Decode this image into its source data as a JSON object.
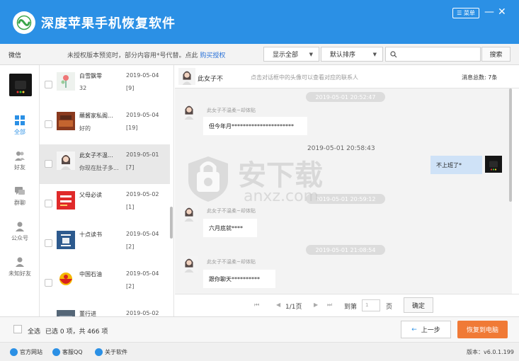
{
  "app": {
    "title": "深度苹果手机恢复软件",
    "menu_label": "菜单",
    "accent": "#2b90e5"
  },
  "toolbar": {
    "app_label": "微信",
    "notice_text": "未授权版本预览时，部分内容用*号代替。点此",
    "notice_link": "购买授权",
    "filter_label": "显示全部",
    "sort_label": "默认排序",
    "search_placeholder": "",
    "search_button": "搜索"
  },
  "nav": {
    "items": [
      {
        "label": "全部",
        "icon": "grid-icon"
      },
      {
        "label": "好友",
        "icon": "friends-icon"
      },
      {
        "label": "群聊",
        "icon": "group-chat-icon"
      },
      {
        "label": "公众号",
        "icon": "official-account-icon"
      },
      {
        "label": "未知好友",
        "icon": "unknown-friend-icon"
      }
    ]
  },
  "contacts": [
    {
      "name": "白雪飘零",
      "preview": "32",
      "date": "2019-05-04",
      "count": "[9]"
    },
    {
      "name": "蘸酱家私阁...",
      "preview": "好的",
      "date": "2019-05-04",
      "count": "[19]"
    },
    {
      "name": "此女子不温...",
      "preview": "你现在肚子多...",
      "date": "2019-05-01",
      "count": "[7]"
    },
    {
      "name": "父母必读",
      "preview": "",
      "date": "2019-05-02",
      "count": "[1]"
    },
    {
      "name": "十点读书",
      "preview": "",
      "date": "2019-05-04",
      "count": "[2]"
    },
    {
      "name": "中国石油",
      "preview": "",
      "date": "2019-05-04",
      "count": "[2]"
    },
    {
      "name": "董行进",
      "preview": "",
      "date": "2019-05-02",
      "count": ""
    }
  ],
  "chat": {
    "contact_name": "此女子不",
    "hint": "点击对话框中的头像可以查看对应的联系人",
    "total": "消息总数: 7条",
    "sender_name": "此女子不温柔~却体贴",
    "times": [
      "2019-05-01 20:52:47",
      "2019-05-01 20:58:43",
      "2019-05-01 20:59:12",
      "2019-05-01 21:08:54"
    ],
    "messages": [
      "但今年月**********************",
      "不上班了*",
      "六月底就****",
      "跟你聊天**********"
    ]
  },
  "pager": {
    "page": "1/1页",
    "goto_label": "到第",
    "page_input": "1",
    "page_unit": "页",
    "ok": "确定"
  },
  "selection": {
    "select_all": "全选",
    "info": "已选 0 项，共 466 项",
    "prev": "上一步",
    "restore": "恢复到电脑",
    "restore_color": "#f07a36"
  },
  "statusbar": {
    "website": "官方网站",
    "qq": "客服QQ",
    "about": "关于软件",
    "version": "版本：v6.0.1.199"
  },
  "watermark": {
    "text": "安下载",
    "sub": "anxz.com"
  }
}
